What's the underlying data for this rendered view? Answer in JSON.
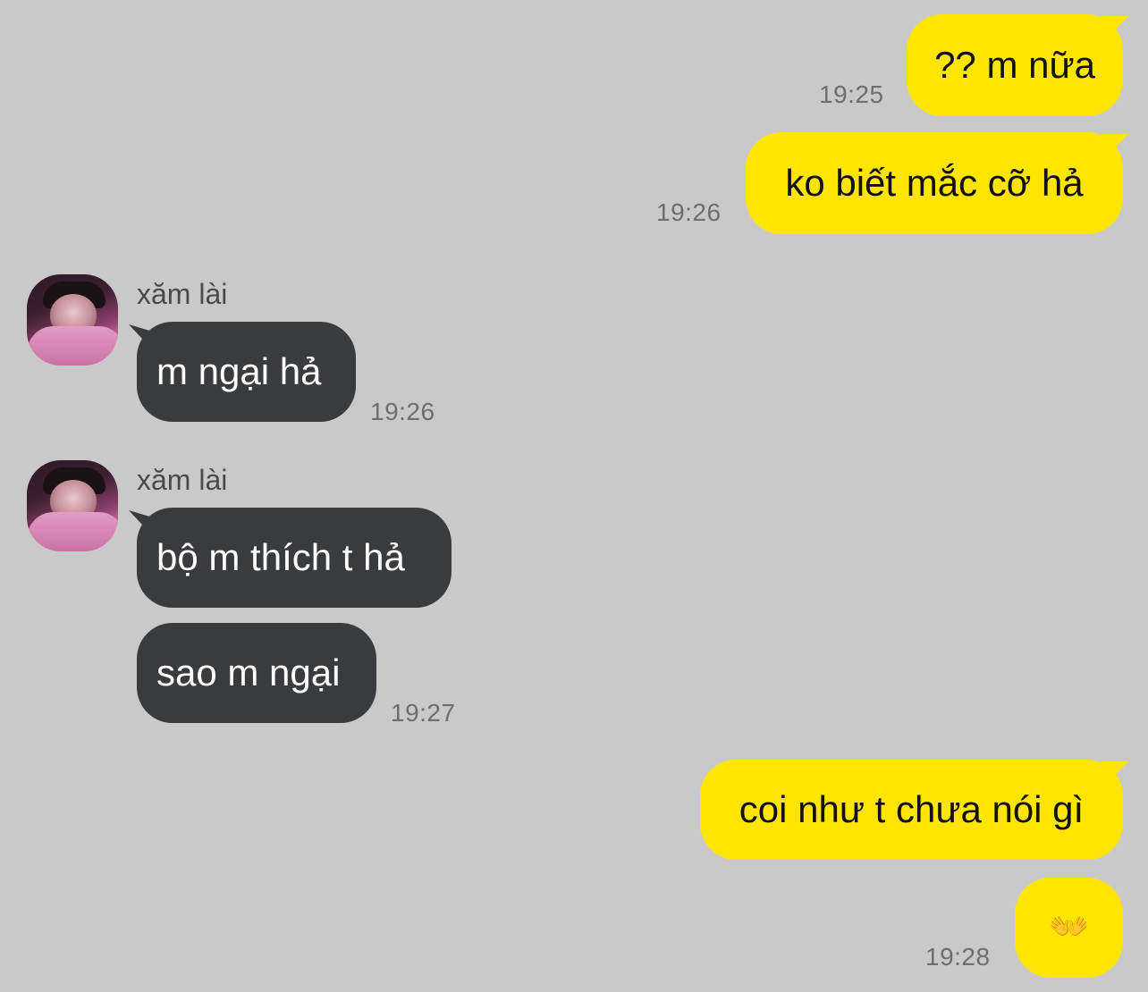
{
  "chat": {
    "outgoing_1": {
      "text": "?? m nữa",
      "time": "19:25"
    },
    "outgoing_2": {
      "text": "ko biết mắc cỡ hả",
      "time": "19:26"
    },
    "incoming_1": {
      "sender": "xăm lài",
      "text": "m ngại hả",
      "time": "19:26"
    },
    "incoming_2": {
      "sender": "xăm lài",
      "text": "bộ m thích t hả"
    },
    "incoming_3": {
      "text": "sao m ngại",
      "time": "19:27"
    },
    "outgoing_3": {
      "text": "coi như t chưa nói gì"
    },
    "outgoing_4": {
      "text": "👐",
      "time": "19:28"
    }
  },
  "colors": {
    "background": "#c9c9c9",
    "outgoing_bubble": "#fee500",
    "incoming_bubble": "#3a3b3e"
  }
}
